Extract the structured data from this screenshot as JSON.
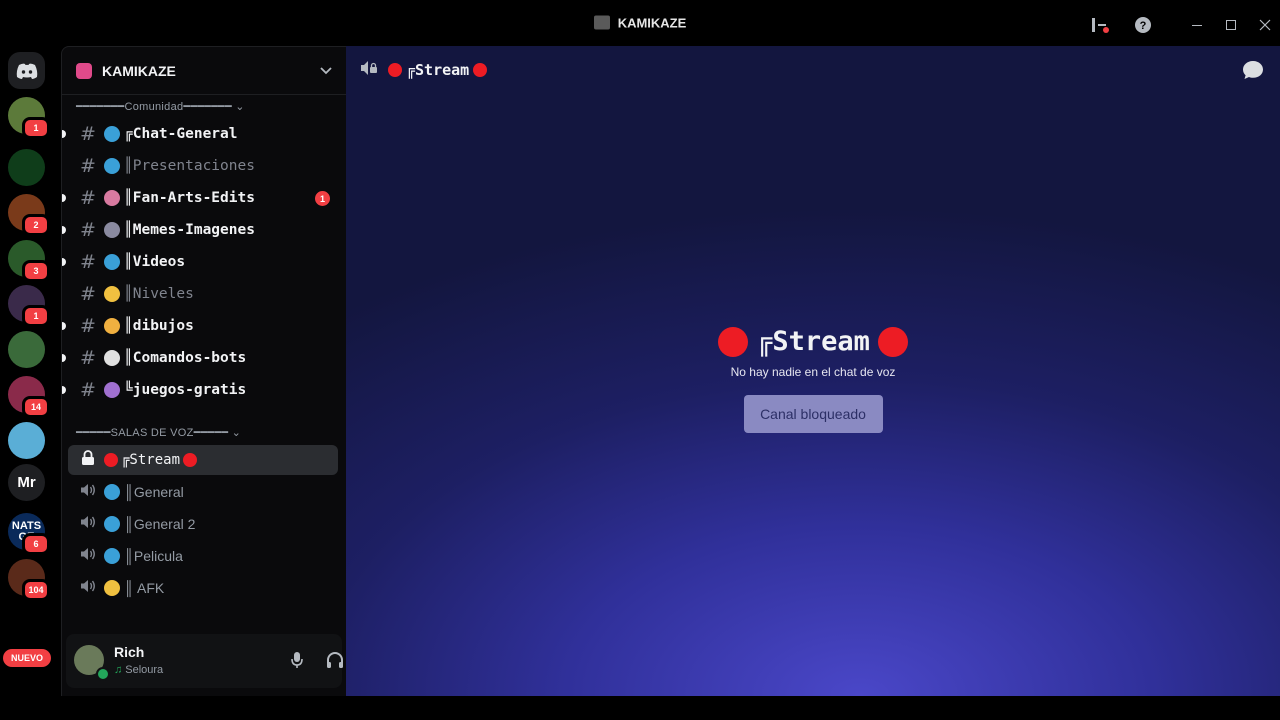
{
  "window": {
    "title": "KAMIKAZE"
  },
  "rail": {
    "servers": [
      {
        "name": "discord-home",
        "text": "",
        "color": "#1e1f22",
        "badge": ""
      },
      {
        "name": "server-1",
        "text": "",
        "color": "#5c7a3a",
        "badge": "1"
      },
      {
        "name": "server-2",
        "text": "",
        "color": "#0f3d1a",
        "badge": ""
      },
      {
        "name": "server-3",
        "text": "",
        "color": "#7a3a1a",
        "badge": "2"
      },
      {
        "name": "server-4",
        "text": "",
        "color": "#2a5a2a",
        "badge": "3"
      },
      {
        "name": "server-5",
        "text": "",
        "color": "#3a2a4a",
        "badge": "1"
      },
      {
        "name": "server-6",
        "text": "",
        "color": "#3a6a3a",
        "badge": ""
      },
      {
        "name": "server-7",
        "text": "",
        "color": "#8a2a4a",
        "badge": "14"
      },
      {
        "name": "server-8",
        "text": "",
        "color": "#5aaed6",
        "badge": ""
      },
      {
        "name": "server-mr",
        "text": "Mr",
        "color": "#1e1f22",
        "badge": ""
      },
      {
        "name": "server-nats",
        "text": "NATS GE",
        "color": "#0a2a5a",
        "badge": "6"
      },
      {
        "name": "server-9",
        "text": "",
        "color": "#5a2a1a",
        "badge": "104"
      }
    ],
    "nuevo_label": "NUEVO"
  },
  "sidebar": {
    "server_name": "KAMIKAZE",
    "category_text": "━━━━━━━Comunidad━━━━━━━",
    "category_voice": "━━━━━SALAS DE VOZ━━━━━",
    "text_channels": [
      {
        "label": "╔Chat-General",
        "emoji_color": "#3aa0d8",
        "unread": true,
        "muted": false,
        "count": ""
      },
      {
        "label": "║Presentaciones",
        "emoji_color": "#3aa0d8",
        "unread": false,
        "muted": true,
        "count": ""
      },
      {
        "label": "║Fan-Arts-Edits",
        "emoji_color": "#d87aa0",
        "unread": true,
        "muted": false,
        "count": "1"
      },
      {
        "label": "║Memes-Imagenes",
        "emoji_color": "#8a8aa0",
        "unread": true,
        "muted": false,
        "count": ""
      },
      {
        "label": "║Videos",
        "emoji_color": "#3aa0d8",
        "unread": true,
        "muted": false,
        "count": ""
      },
      {
        "label": "║Niveles",
        "emoji_color": "#f0c040",
        "unread": false,
        "muted": true,
        "count": ""
      },
      {
        "label": "║dibujos",
        "emoji_color": "#f0b040",
        "unread": true,
        "muted": false,
        "count": ""
      },
      {
        "label": "║Comandos-bots",
        "emoji_color": "#e0e0e0",
        "unread": true,
        "muted": false,
        "count": ""
      },
      {
        "label": "╚juegos-gratis",
        "emoji_color": "#a070d0",
        "unread": true,
        "muted": false,
        "count": ""
      }
    ],
    "voice_channels": [
      {
        "label": "╔Stream",
        "active": true
      },
      {
        "label": "║General",
        "active": false
      },
      {
        "label": "║General 2",
        "active": false
      },
      {
        "label": "║Pelicula",
        "active": false
      },
      {
        "label": "║ AFK",
        "active": false
      }
    ]
  },
  "user": {
    "name": "Rich",
    "activity": "Seloura"
  },
  "main": {
    "header_title": "╔Stream",
    "center_title": "╔Stream",
    "center_subtitle": "No hay nadie en el chat de voz",
    "locked_button": "Canal bloqueado"
  }
}
